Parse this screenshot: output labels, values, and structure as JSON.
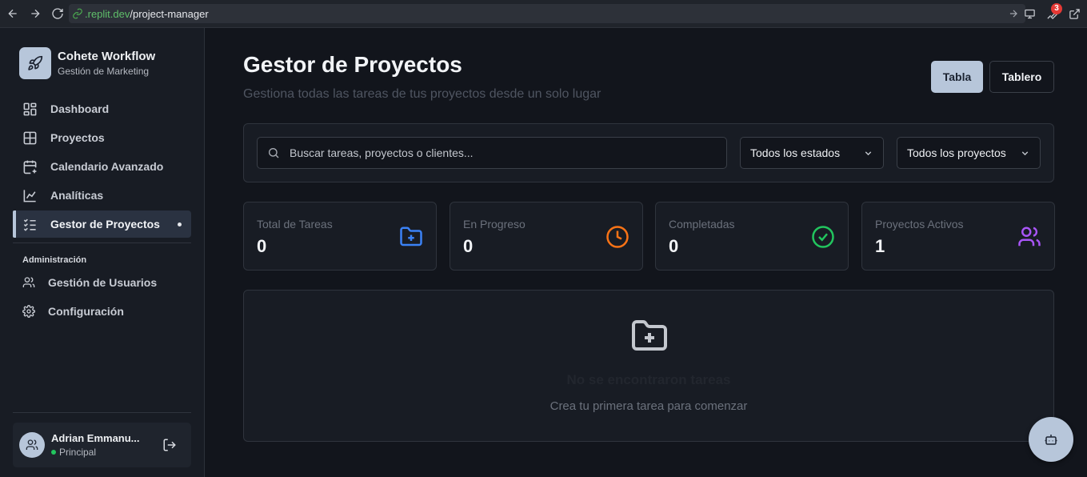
{
  "browser": {
    "url_host": ".replit.dev",
    "url_path": "/project-manager",
    "notification_count": "3"
  },
  "sidebar": {
    "brand_title": "Cohete Workflow",
    "brand_subtitle": "Gestión de Marketing",
    "items": [
      {
        "label": "Dashboard",
        "icon": "dashboard-icon"
      },
      {
        "label": "Proyectos",
        "icon": "grid-icon"
      },
      {
        "label": "Calendario Avanzado",
        "icon": "calendar-plus-icon"
      },
      {
        "label": "Analíticas",
        "icon": "line-chart-icon"
      },
      {
        "label": "Gestor de Proyectos",
        "icon": "list-check-icon",
        "active": true
      }
    ],
    "admin_label": "Administración",
    "admin_items": [
      {
        "label": "Gestión de Usuarios",
        "icon": "users-icon"
      },
      {
        "label": "Configuración",
        "icon": "gear-icon"
      }
    ],
    "user": {
      "name": "Adrian Emmanu...",
      "role": "Principal"
    }
  },
  "main": {
    "title": "Gestor de Proyectos",
    "subtitle": "Gestiona todas las tareas de tus proyectos desde un solo lugar",
    "view_buttons": {
      "table": "Tabla",
      "board": "Tablero"
    },
    "search_placeholder": "Buscar tareas, proyectos o clientes...",
    "status_filter": "Todos los estados",
    "project_filter": "Todos los proyectos",
    "stats": [
      {
        "label": "Total de Tareas",
        "value": "0",
        "icon": "folder-plus-icon",
        "color": "#3b82f6"
      },
      {
        "label": "En Progreso",
        "value": "0",
        "icon": "clock-icon",
        "color": "#f97316"
      },
      {
        "label": "Completadas",
        "value": "0",
        "icon": "check-circle-icon",
        "color": "#22c55e"
      },
      {
        "label": "Proyectos Activos",
        "value": "1",
        "icon": "users-icon",
        "color": "#a855f7"
      }
    ],
    "empty": {
      "title": "No se encontraron tareas",
      "subtitle": "Crea tu primera tarea para comenzar"
    }
  },
  "colors": {
    "accent": "#b7c6da",
    "background": "#12151c",
    "sidebar": "#181c24"
  }
}
